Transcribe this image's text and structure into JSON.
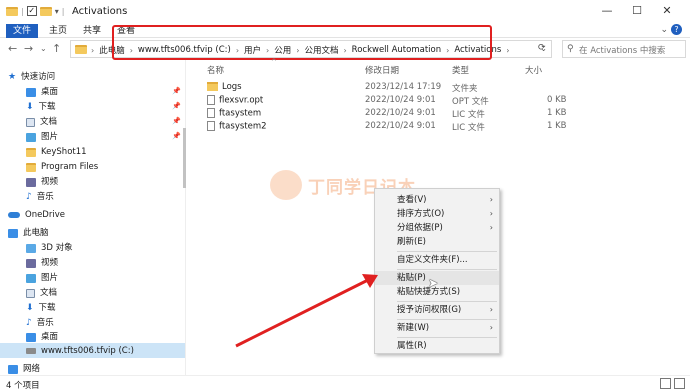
{
  "window": {
    "title": "Activations",
    "controls": {
      "minimize": "—",
      "maximize": "☐",
      "close": "✕"
    }
  },
  "ribbon": {
    "tabs": [
      "文件",
      "主页",
      "共享",
      "查看"
    ],
    "help": "⌄"
  },
  "address": {
    "crumbs": [
      "此电脑",
      "www.tfts006.tfvip (C:)",
      "用户",
      "公用",
      "公用文档",
      "Rockwell Automation",
      "Activations"
    ],
    "search_placeholder": "在 Activations 中搜索"
  },
  "sidebar": {
    "items": [
      {
        "label": "快速访问",
        "icon": "star-icon"
      },
      {
        "label": "桌面",
        "icon": "desktop-icon",
        "pinned": true
      },
      {
        "label": "下载",
        "icon": "download-icon",
        "pinned": true
      },
      {
        "label": "文档",
        "icon": "document-icon",
        "pinned": true
      },
      {
        "label": "图片",
        "icon": "picture-icon",
        "pinned": true
      },
      {
        "label": "KeyShot11",
        "icon": "folder-icon"
      },
      {
        "label": "Program Files",
        "icon": "folder-icon"
      },
      {
        "label": "视频",
        "icon": "video-icon"
      },
      {
        "label": "音乐",
        "icon": "music-icon"
      },
      {
        "label": "OneDrive",
        "icon": "cloud-icon"
      },
      {
        "label": "此电脑",
        "icon": "computer-icon"
      },
      {
        "label": "3D 对象",
        "icon": "cube-icon"
      },
      {
        "label": "视频",
        "icon": "video-icon"
      },
      {
        "label": "图片",
        "icon": "picture-icon"
      },
      {
        "label": "文档",
        "icon": "document-icon"
      },
      {
        "label": "下载",
        "icon": "download-icon"
      },
      {
        "label": "音乐",
        "icon": "music-icon"
      },
      {
        "label": "桌面",
        "icon": "desktop-icon"
      },
      {
        "label": "www.tfts006.tfvip (C:)",
        "icon": "drive-icon"
      },
      {
        "label": "网络",
        "icon": "network-icon"
      }
    ]
  },
  "columns": {
    "name": "名称",
    "modified": "修改日期",
    "type": "类型",
    "size": "大小"
  },
  "files": [
    {
      "name": "Logs",
      "modified": "2023/12/14 17:19",
      "type": "文件夹",
      "size": "",
      "kind": "folder"
    },
    {
      "name": "flexsvr.opt",
      "modified": "2022/10/24 9:01",
      "type": "OPT 文件",
      "size": "0 KB",
      "kind": "file"
    },
    {
      "name": "ftasystem",
      "modified": "2022/10/24 9:01",
      "type": "LIC 文件",
      "size": "1 KB",
      "kind": "file"
    },
    {
      "name": "ftasystem2",
      "modified": "2022/10/24 9:01",
      "type": "LIC 文件",
      "size": "1 KB",
      "kind": "file"
    }
  ],
  "watermark": "丁同学日记本",
  "context_menu": [
    {
      "label": "查看(V)",
      "submenu": true
    },
    {
      "label": "排序方式(O)",
      "submenu": true
    },
    {
      "label": "分组依据(P)",
      "submenu": true
    },
    {
      "label": "刷新(E)",
      "submenu": false
    },
    {
      "label": "自定义文件夹(F)...",
      "submenu": false
    },
    {
      "label": "粘贴(P)",
      "submenu": false
    },
    {
      "label": "粘贴快捷方式(S)",
      "submenu": false
    },
    {
      "label": "授予访问权限(G)",
      "submenu": true
    },
    {
      "label": "新建(W)",
      "submenu": true
    },
    {
      "label": "属性(R)",
      "submenu": false
    }
  ],
  "status": {
    "item_count": "4 个项目"
  },
  "colors": {
    "accent": "#1f5fbf",
    "annotation": "#e02020",
    "selection": "#cce4f7"
  }
}
